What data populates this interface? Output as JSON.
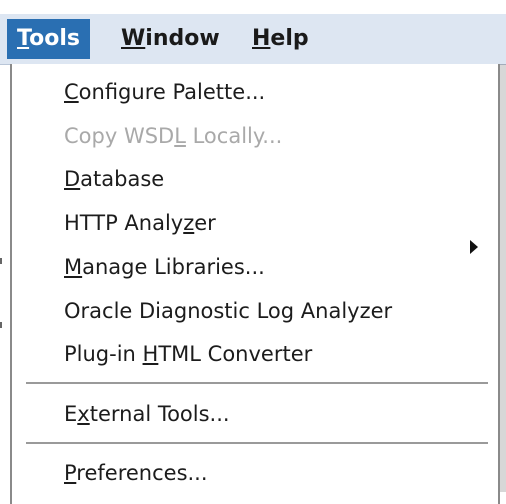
{
  "menubar": {
    "items": [
      {
        "label": "Tools",
        "mnemonic": "T",
        "active": true
      },
      {
        "label": "Window",
        "mnemonic": "W",
        "active": false
      },
      {
        "label": "Help",
        "mnemonic": "H",
        "active": false
      }
    ]
  },
  "tools_menu": {
    "items": [
      {
        "label": "Configure Palette...",
        "mnemonic": "C",
        "enabled": true
      },
      {
        "label": "Copy WSDL Locally...",
        "mnemonic": "L",
        "enabled": false
      },
      {
        "label": "Database",
        "mnemonic": "D",
        "enabled": true,
        "submenu": true
      },
      {
        "label": "HTTP Analyzer",
        "mnemonic": "z",
        "enabled": true
      },
      {
        "label": "Manage Libraries...",
        "mnemonic": "M",
        "enabled": true
      },
      {
        "label": "Oracle Diagnostic Log Analyzer",
        "enabled": true
      },
      {
        "label": "Plug-in HTML Converter",
        "mnemonic": "H",
        "enabled": true
      },
      {
        "label": "External Tools...",
        "mnemonic": "x",
        "enabled": true
      },
      {
        "label": "Preferences...",
        "mnemonic": "P",
        "enabled": true
      }
    ]
  },
  "colors": {
    "menubar_bg": "#dde6f2",
    "active_menu_bg": "#2a6fb2",
    "disabled_text": "#a9a9a9"
  }
}
